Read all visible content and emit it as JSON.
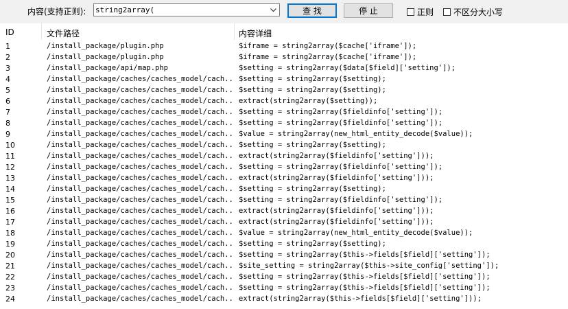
{
  "toolbar": {
    "content_label": "内容(支持正则):",
    "search_value": "string2array(",
    "find_label": "查 找",
    "stop_label": "停 止",
    "regex_label": "正则",
    "ignore_case_label": "不区分大小写"
  },
  "table": {
    "columns": [
      "ID",
      "文件路径",
      "内容详细"
    ],
    "rows": [
      {
        "id": "1",
        "path": "/install_package/plugin.php",
        "detail": "$iframe = string2array($cache['iframe']);"
      },
      {
        "id": "2",
        "path": "/install_package/plugin.php",
        "detail": "$iframe = string2array($cache['iframe']);"
      },
      {
        "id": "3",
        "path": "/install_package/api/map.php",
        "detail": "$setting = string2array($data[$field]['setting']);"
      },
      {
        "id": "4",
        "path": "/install_package/caches/caches_model/cach...",
        "detail": "$setting = string2array($setting);"
      },
      {
        "id": "5",
        "path": "/install_package/caches/caches_model/cach...",
        "detail": "$setting = string2array($setting);"
      },
      {
        "id": "6",
        "path": "/install_package/caches/caches_model/cach...",
        "detail": "extract(string2array($setting));"
      },
      {
        "id": "7",
        "path": "/install_package/caches/caches_model/cach...",
        "detail": "$setting = string2array($fieldinfo['setting']);"
      },
      {
        "id": "8",
        "path": "/install_package/caches/caches_model/cach...",
        "detail": "$setting = string2array($fieldinfo['setting']);"
      },
      {
        "id": "9",
        "path": "/install_package/caches/caches_model/cach...",
        "detail": "$value = string2array(new_html_entity_decode($value));"
      },
      {
        "id": "10",
        "path": "/install_package/caches/caches_model/cach...",
        "detail": "$setting = string2array($setting);"
      },
      {
        "id": "11",
        "path": "/install_package/caches/caches_model/cach...",
        "detail": "extract(string2array($fieldinfo['setting']));"
      },
      {
        "id": "12",
        "path": "/install_package/caches/caches_model/cach...",
        "detail": "$setting = string2array($fieldinfo['setting']);"
      },
      {
        "id": "13",
        "path": "/install_package/caches/caches_model/cach...",
        "detail": "extract(string2array($fieldinfo['setting']));"
      },
      {
        "id": "14",
        "path": "/install_package/caches/caches_model/cach...",
        "detail": "$setting = string2array($setting);"
      },
      {
        "id": "15",
        "path": "/install_package/caches/caches_model/cach...",
        "detail": "$setting = string2array($fieldinfo['setting']);"
      },
      {
        "id": "16",
        "path": "/install_package/caches/caches_model/cach...",
        "detail": "extract(string2array($fieldinfo['setting']));"
      },
      {
        "id": "17",
        "path": "/install_package/caches/caches_model/cach...",
        "detail": "extract(string2array($fieldinfo['setting']));"
      },
      {
        "id": "18",
        "path": "/install_package/caches/caches_model/cach...",
        "detail": "$value = string2array(new_html_entity_decode($value));"
      },
      {
        "id": "19",
        "path": "/install_package/caches/caches_model/cach...",
        "detail": "$setting = string2array($setting);"
      },
      {
        "id": "20",
        "path": "/install_package/caches/caches_model/cach...",
        "detail": "$setting = string2array($this->fields[$field]['setting']);"
      },
      {
        "id": "21",
        "path": "/install_package/caches/caches_model/cach...",
        "detail": "$site_setting = string2array($this->site_config['setting']);"
      },
      {
        "id": "22",
        "path": "/install_package/caches/caches_model/cach...",
        "detail": "$setting = string2array($this->fields[$field]['setting']);"
      },
      {
        "id": "23",
        "path": "/install_package/caches/caches_model/cach...",
        "detail": "$setting = string2array($this->fields[$field]['setting']);"
      },
      {
        "id": "24",
        "path": "/install_package/caches/caches_model/cach...",
        "detail": "extract(string2array($this->fields[$field]['setting']));"
      }
    ]
  }
}
